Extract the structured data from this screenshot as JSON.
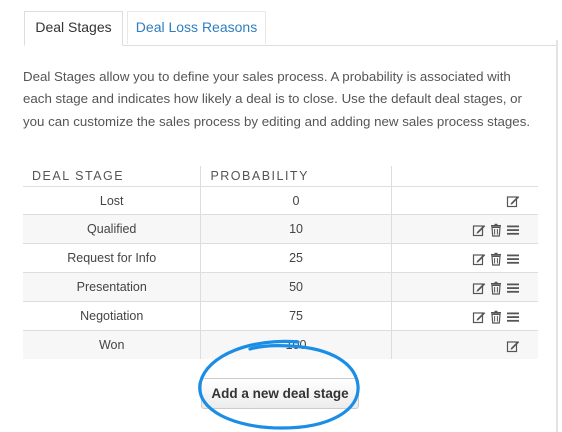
{
  "tabs": [
    {
      "label": "Deal Stages",
      "active": true
    },
    {
      "label": "Deal Loss Reasons",
      "active": false
    }
  ],
  "description": "Deal Stages allow you to define your sales process. A probability is associated with each stage and indicates how likely a deal is to close. Use the default deal stages, or you can customize the sales process by editing and adding new sales process stages.",
  "table": {
    "headers": {
      "stage": "DEAL STAGE",
      "probability": "PROBABILITY",
      "actions": ""
    },
    "rows": [
      {
        "stage": "Lost",
        "probability": "0",
        "actions": [
          "edit"
        ]
      },
      {
        "stage": "Qualified",
        "probability": "10",
        "actions": [
          "edit",
          "delete",
          "reorder"
        ]
      },
      {
        "stage": "Request for Info",
        "probability": "25",
        "actions": [
          "edit",
          "delete",
          "reorder"
        ]
      },
      {
        "stage": "Presentation",
        "probability": "50",
        "actions": [
          "edit",
          "delete",
          "reorder"
        ]
      },
      {
        "stage": "Negotiation",
        "probability": "75",
        "actions": [
          "edit",
          "delete",
          "reorder"
        ]
      },
      {
        "stage": "Won",
        "probability": "100",
        "actions": [
          "edit"
        ]
      }
    ]
  },
  "add_button": {
    "label": "Add a new deal stage"
  },
  "icons": {
    "edit": "edit-icon",
    "delete": "trash-icon",
    "reorder": "drag-handle-icon"
  },
  "colors": {
    "link": "#2f7ec1",
    "highlight": "#1a8ee6",
    "border": "#dddddd"
  }
}
